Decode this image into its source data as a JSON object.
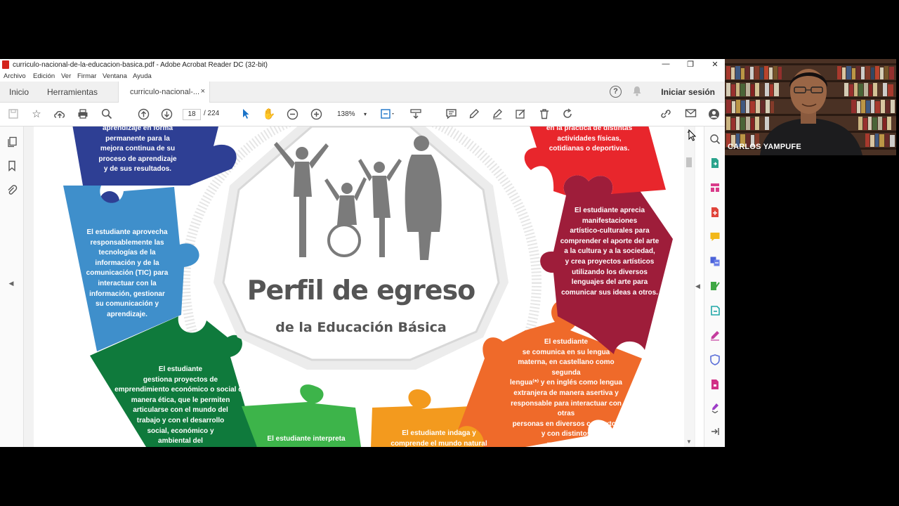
{
  "window": {
    "title": "curriculo-nacional-de-la-educacion-basica.pdf - Adobe Acrobat Reader DC (32-bit)",
    "controls": {
      "minimize": "—",
      "restore": "❐",
      "close": "✕"
    }
  },
  "menu": [
    "Archivo",
    "Edición",
    "Ver",
    "Firmar",
    "Ventana",
    "Ayuda"
  ],
  "tabs": {
    "home": "Inicio",
    "tools": "Herramientas",
    "document": "curriculo-nacional-...",
    "close": "×"
  },
  "header": {
    "signin": "Iniciar sesión"
  },
  "toolbar": {
    "page_current": "18",
    "page_total": "/  224",
    "zoom": "138%",
    "zoom_arrow": "▾"
  },
  "pdf": {
    "title_line1": "Perfil de egreso",
    "title_line2": "de la Educación Básica",
    "pieces": {
      "dark_blue": "aprendizaje en forma\npermanente para la\nmejora continua de su\nproceso de aprendizaje\ny de sus resultados.",
      "light_blue": "El estudiante aprovecha\nresponsablemente las\ntecnologías de la\ninformación y de la\ncomunicación (TIC) para\ninteractuar con la\ninformación, gestionar\nsu comunicación y\naprendizaje.",
      "dark_green": "El estudiante\ngestiona proyectos de\nemprendimiento económico o social de\nmanera ética, que le permiten\narticularse con el mundo del\ntrabajo y con el desarrollo\nsocial, económico y\nambiental del",
      "green": "El estudiante interpreta",
      "orange_bottom": "El estudiante indaga y\ncomprende el mundo natural",
      "orange": "El estudiante\nse comunica en su lengua\nmaterna, en castellano como segunda\nlengua⁽*⁾ y en inglés como lengua\nextranjera de manera asertiva y\nresponsable para interactuar con otras\npersonas en diversos contextos\ny con distintos\npropósitos.",
      "maroon": "El estudiante aprecia\nmanifestaciones\nartístico-culturales para\ncomprender el aporte del arte\na la cultura y a la sociedad,\ny crea proyectos artísticos\nutilizando los diversos\nlenguajes del arte para\ncomunicar sus ideas a otros.",
      "red": "en la práctica de distintas\nactividades físicas,\ncotidianas o deportivas."
    }
  },
  "webcam": {
    "name": "CARLOS YAMPUFE"
  },
  "colors": {
    "dark_blue": "#2e3f94",
    "light_blue": "#3f8fcb",
    "dark_green": "#0f7a3c",
    "green": "#3db44a",
    "orange_bottom": "#f39a1e",
    "orange": "#ef6a2a",
    "maroon": "#9e1d3a",
    "red": "#e8262c"
  }
}
